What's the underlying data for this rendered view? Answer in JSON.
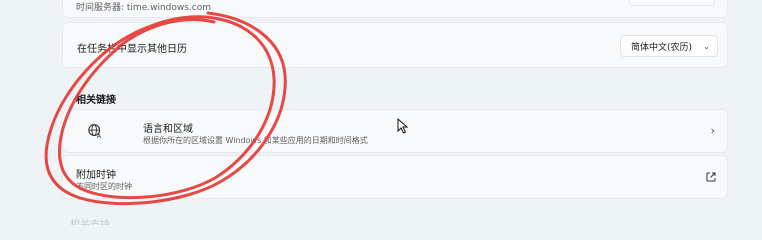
{
  "time_server": {
    "label": "时间服务器: time.windows.com"
  },
  "show_calendar": {
    "label": "在任务栏中显示其他日历",
    "dropdown_value": "简体中文(农历)",
    "dropdown_icon": "chevron-down-icon"
  },
  "related_links": {
    "title": "相关链接"
  },
  "language_region": {
    "title": "语言和区域",
    "subtitle": "根据你所在的区域设置 Windows 和某些应用的日期和时间格式",
    "icon": "language-icon",
    "chevron": "›"
  },
  "additional_clocks": {
    "title": "附加时钟",
    "subtitle": "不同时区的时钟",
    "icon": "external-link-icon"
  },
  "next_section": {
    "title": "相关支持"
  },
  "annotation": {
    "color": "#e53935",
    "type": "freehand-circle"
  },
  "theme": {
    "background": "#eef3f6",
    "card": "#f7f9fb"
  }
}
